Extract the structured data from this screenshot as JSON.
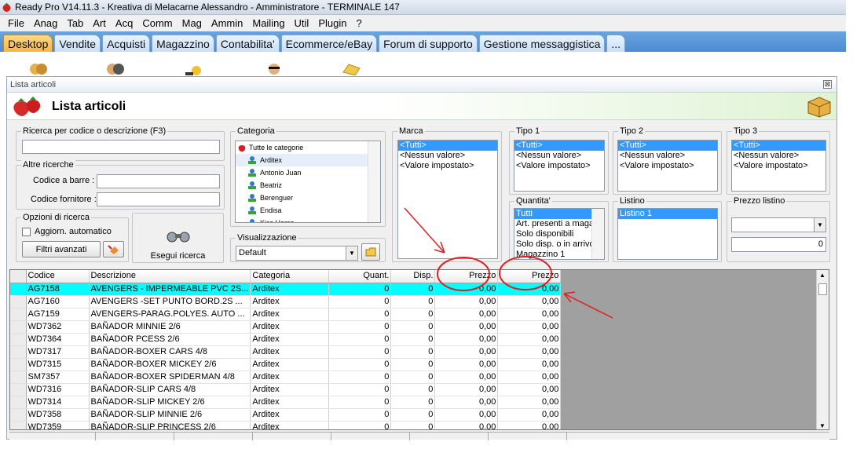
{
  "window_title": "Ready Pro V14.11.3 - Kreativa di Melacarne Alessandro - Amministratore - TERMINALE 147",
  "menu": [
    "File",
    "Anag",
    "Tab",
    "Art",
    "Acq",
    "Comm",
    "Mag",
    "Ammin",
    "Mailing",
    "Util",
    "Plugin",
    "?"
  ],
  "tabs": [
    {
      "label": "Desktop",
      "active": true
    },
    {
      "label": "Vendite"
    },
    {
      "label": "Acquisti"
    },
    {
      "label": "Magazzino"
    },
    {
      "label": "Contabilita'"
    },
    {
      "label": "Ecommerce/eBay"
    },
    {
      "label": "Forum di supporto"
    },
    {
      "label": "Gestione messaggistica"
    },
    {
      "label": "..."
    }
  ],
  "child_window": {
    "title": "Lista articoli",
    "close_glyph": "⊠",
    "header_title": "Lista articoli"
  },
  "search": {
    "legend": "Ricerca per codice o descrizione (F3)",
    "value": "",
    "other_legend": "Altre ricerche",
    "barcode_label": "Codice a barre :",
    "barcode_value": "",
    "supplier_label": "Codice fornitore :",
    "supplier_value": "",
    "options_legend": "Opzioni di ricerca",
    "auto_update_label": "Aggiorn. automatico",
    "advanced_filters_label": "Filtri avanzati",
    "run_search_label": "Esegui ricerca"
  },
  "categoria": {
    "legend": "Categoria",
    "items": [
      "Tutte le categorie",
      "Arditex",
      "Antonio Juan",
      "Beatriz",
      "Berenguer",
      "Endisa",
      "Kiss Horse"
    ]
  },
  "visualizzazione": {
    "legend": "Visualizzazione",
    "selected": "Default"
  },
  "marca": {
    "legend": "Marca",
    "items": [
      "<Tutti>",
      "<Nessun valore>",
      "<Valore impostato>"
    ]
  },
  "tipo1": {
    "legend": "Tipo 1",
    "items": [
      "<Tutti>",
      "<Nessun valore>",
      "<Valore impostato>"
    ]
  },
  "tipo2": {
    "legend": "Tipo 2",
    "items": [
      "<Tutti>",
      "<Nessun valore>",
      "<Valore impostato>"
    ]
  },
  "tipo3": {
    "legend": "Tipo 3",
    "items": [
      "<Tutti>",
      "<Nessun valore>",
      "<Valore impostato>"
    ]
  },
  "quantita": {
    "legend": "Quantita'",
    "items": [
      "Tutti",
      "Art. presenti a magaz",
      "Solo disponibili",
      "Solo disp. o in arrivo",
      "Magazzino 1"
    ]
  },
  "listino": {
    "legend": "Listino",
    "items": [
      "Listino 1"
    ]
  },
  "prezzo_listino": {
    "legend": "Prezzo listino",
    "select_value": "",
    "value": "0"
  },
  "grid": {
    "columns": [
      "Codice",
      "Descrizione",
      "Categoria",
      "Quant.",
      "Disp.",
      "Prezzo",
      "Prezzo"
    ],
    "rows": [
      [
        "AG7158",
        "AVENGERS - IMPERMEABLE PVC 2S...",
        "Arditex",
        "0",
        "0",
        "0,00",
        "0,00"
      ],
      [
        "AG7160",
        "AVENGERS -SET PUNTO BORD.2S ...",
        "Arditex",
        "0",
        "0",
        "0,00",
        "0,00"
      ],
      [
        "AG7159",
        "AVENGERS-PARAG.POLYES. AUTO ...",
        "Arditex",
        "0",
        "0",
        "0,00",
        "0,00"
      ],
      [
        "WD7362",
        "BAÑADOR MINNIE 2/6",
        "Arditex",
        "0",
        "0",
        "0,00",
        "0,00"
      ],
      [
        "WD7364",
        "BAÑADOR PCESS 2/6",
        "Arditex",
        "0",
        "0",
        "0,00",
        "0,00"
      ],
      [
        "WD7317",
        "BAÑADOR-BOXER CARS 4/8",
        "Arditex",
        "0",
        "0",
        "0,00",
        "0,00"
      ],
      [
        "WD7315",
        "BAÑADOR-BOXER MICKEY 2/6",
        "Arditex",
        "0",
        "0",
        "0,00",
        "0,00"
      ],
      [
        "SM7357",
        "BAÑADOR-BOXER SPIDERMAN 4/8",
        "Arditex",
        "0",
        "0",
        "0,00",
        "0,00"
      ],
      [
        "WD7316",
        "BAÑADOR-SLIP CARS 4/8",
        "Arditex",
        "0",
        "0",
        "0,00",
        "0,00"
      ],
      [
        "WD7314",
        "BAÑADOR-SLIP MICKEY 2/6",
        "Arditex",
        "0",
        "0",
        "0,00",
        "0,00"
      ],
      [
        "WD7358",
        "BAÑADOR-SLIP MINNIE 2/6",
        "Arditex",
        "0",
        "0",
        "0,00",
        "0,00"
      ],
      [
        "WD7359",
        "BAÑADOR-SLIP PRINCESS 2/6",
        "Arditex",
        "0",
        "0",
        "0,00",
        "0,00"
      ]
    ]
  },
  "colors": {
    "accent_red": "#e02020",
    "selection": "#3399ff",
    "row_highlight": "#00ffff",
    "tab_active": "#f4b546"
  }
}
